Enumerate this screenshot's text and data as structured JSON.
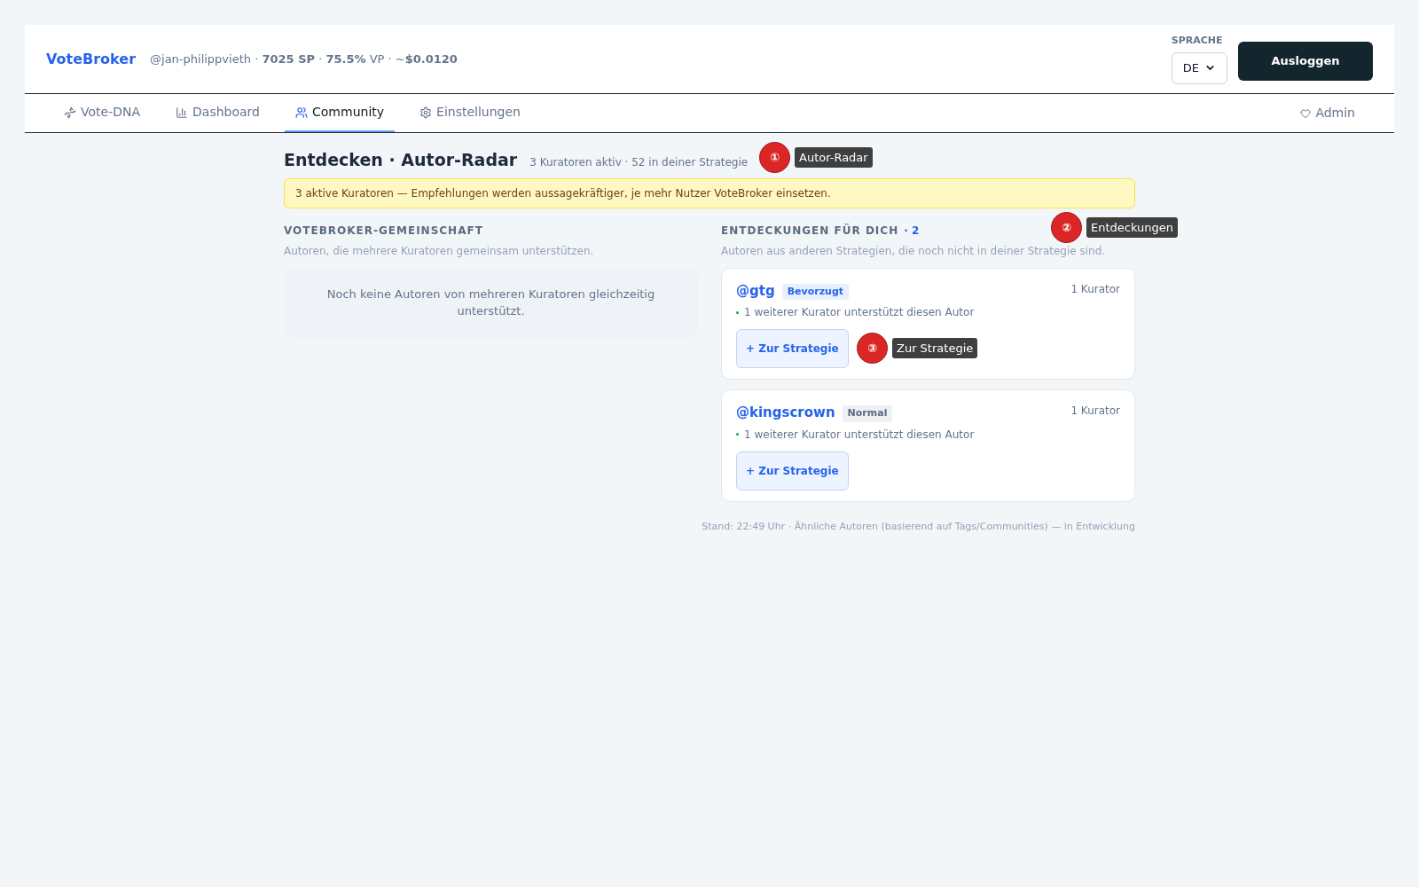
{
  "header": {
    "brand": "VoteBroker",
    "stats": "@jan-philippvieth · **7025 SP** · **75.5%** VP · ~**$0.0120**",
    "language": {
      "label": "SPRACHE",
      "value": "DE"
    },
    "logout": "Ausloggen"
  },
  "nav": {
    "tabs": [
      {
        "label": "Vote-DNA",
        "selected": false
      },
      {
        "label": "Dashboard",
        "selected": false
      },
      {
        "label": "Community",
        "selected": true
      },
      {
        "label": "Einstellungen",
        "selected": false
      }
    ],
    "admin": "Admin"
  },
  "page": {
    "title": "Entdecken · Autor-Radar",
    "subtitle": "3 Kuratoren aktiv · 52 in deiner Strategie",
    "notice": "3 aktive Kuratoren — Empfehlungen werden aussagekräftiger, je mehr Nutzer VoteBroker einsetzen."
  },
  "community": {
    "heading": "VOTEBROKER-GEMEINSCHAFT",
    "description": "Autoren, die mehrere Kuratoren gemeinsam unterstützen.",
    "empty": "Noch keine Autoren von mehreren Kuratoren gleichzeitig unterstützt."
  },
  "discoveries": {
    "heading": "ENTDECKUNGEN FÜR DICH",
    "count": "· 2",
    "description": "Autoren aus anderen Strategien, die noch nicht in deiner Strategie sind.",
    "authors": [
      {
        "handle": "@gtg",
        "badge": {
          "label": "Bevorzugt",
          "kind": "preferred"
        },
        "curators": "1 Kurator",
        "note": "1 weiterer Kurator unterstützt diesen Autor",
        "button": "+ Zur Strategie"
      },
      {
        "handle": "@kingscrown",
        "badge": {
          "label": "Normal",
          "kind": "normal"
        },
        "curators": "1 Kurator",
        "note": "1 weiterer Kurator unterstützt diesen Autor",
        "button": "+ Zur Strategie"
      }
    ]
  },
  "footer": "Stand: 22:49 Uhr · Ähnliche Autoren (basierend auf Tags/Communities) — in Entwicklung",
  "annotations": [
    {
      "number": "①",
      "label": "Autor-Radar"
    },
    {
      "number": "②",
      "label": "Entdeckungen"
    },
    {
      "number": "③",
      "label": "Zur Strategie"
    }
  ]
}
